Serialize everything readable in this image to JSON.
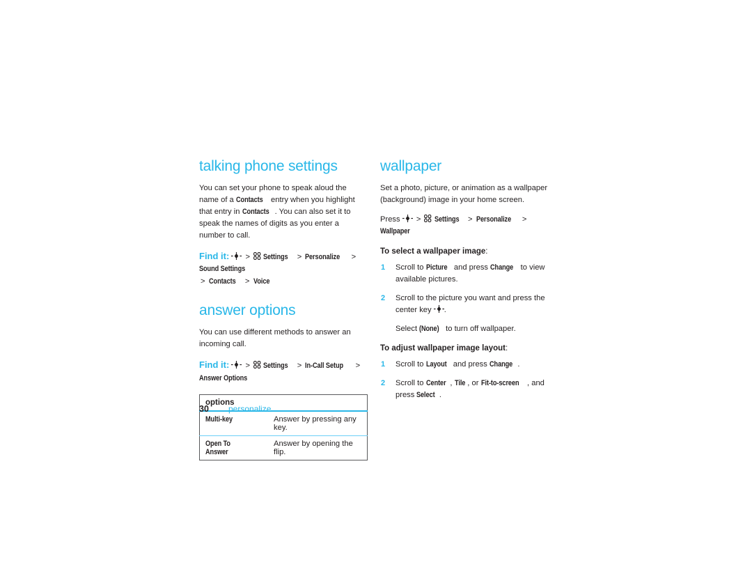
{
  "colors": {
    "accent": "#29b7e8",
    "text": "#231f20",
    "table_border": "#58595b",
    "table_divider": "#6dcff6"
  },
  "left_column": {
    "talking_phone_settings": {
      "title": "talking phone settings",
      "paragraph_1_part1": "You can set your phone to speak aloud the name of a ",
      "paragraph_1_term1": "Contacts",
      "paragraph_1_part2": " entry when you highlight that entry in ",
      "paragraph_1_term2": "Contacts",
      "paragraph_1_part3": ". You can also set it to speak the names of digits as you enter a number to call.",
      "findit_label": "Find it:",
      "findit_path": [
        "Settings",
        "Personalize",
        "Sound Settings",
        "Contacts",
        "Voice"
      ]
    },
    "answer_options": {
      "title": "answer options",
      "paragraph": "You can use different methods to answer an incoming call.",
      "findit_label": "Find it:",
      "findit_path": [
        "Settings",
        "In-Call Setup",
        "Answer Options"
      ],
      "table": {
        "header": "options",
        "rows": [
          {
            "option": "Multi-key",
            "description": "Answer by pressing any key."
          },
          {
            "option": "Open To Answer",
            "description": "Answer by opening the flip."
          }
        ]
      }
    }
  },
  "right_column": {
    "wallpaper": {
      "title": "wallpaper",
      "paragraph": "Set a photo, picture, or animation as a wallpaper (background) image in your home screen.",
      "press_label": "Press",
      "press_path": [
        "Settings",
        "Personalize",
        "Wallpaper"
      ],
      "select_image": {
        "heading": "To select a wallpaper image",
        "heading_colon": ":",
        "steps": [
          {
            "num": "1",
            "part1": "Scroll to ",
            "term1": "Picture",
            "part2": " and press ",
            "term2": "Change",
            "part3": " to view available pictures."
          },
          {
            "num": "2",
            "part1": "Scroll to the picture you want and press the center key ",
            "part3": "."
          }
        ],
        "note_part1": "Select ",
        "note_term": "(None)",
        "note_part2": " to turn off wallpaper."
      },
      "adjust_layout": {
        "heading": "To adjust wallpaper image layout",
        "heading_colon": ":",
        "steps": [
          {
            "num": "1",
            "part1": "Scroll to ",
            "term1": "Layout",
            "part2": " and press ",
            "term2": "Change",
            "part3": "."
          },
          {
            "num": "2",
            "part1": "Scroll to ",
            "term1": "Center",
            "part2": ", ",
            "term2": "Tile",
            "part3": ", or ",
            "term3": "Fit-to-screen",
            "part4": ", and press ",
            "term4": "Select",
            "part5": "."
          }
        ]
      }
    }
  },
  "footer": {
    "page_number": "30",
    "chapter": "personalize"
  }
}
